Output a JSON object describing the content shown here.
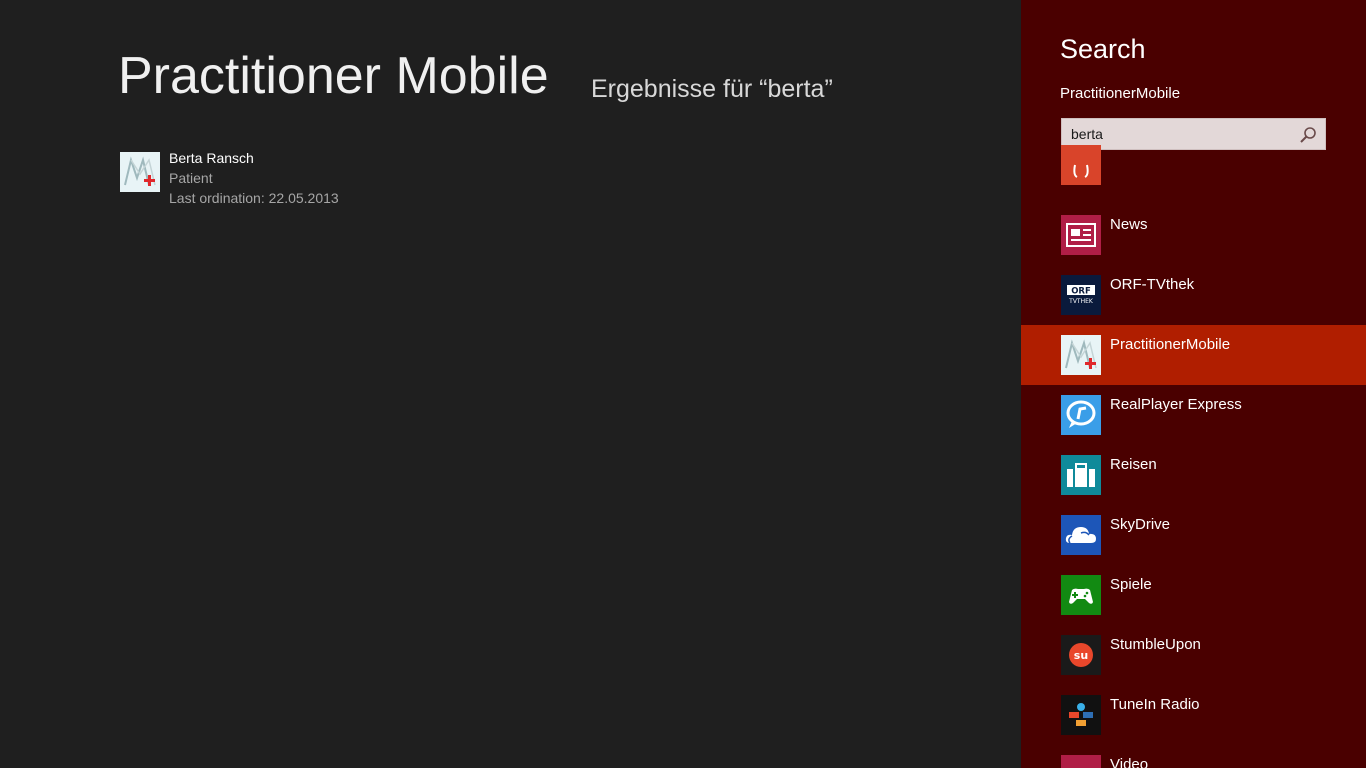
{
  "main": {
    "app_title": "Practitioner Mobile",
    "results_label": "Ergebnisse für “berta”",
    "results": [
      {
        "name": "Berta Ransch",
        "type": "Patient",
        "last_ordination": "Last ordination: 22.05.2013"
      }
    ]
  },
  "charm": {
    "title": "Search",
    "scope": "PractitionerMobile",
    "query": "berta",
    "apps": [
      {
        "label": "",
        "color": "#d9442a",
        "icon": "partial-app-icon"
      },
      {
        "label": "News",
        "color": "#b01e46",
        "icon": "news-icon"
      },
      {
        "label": "ORF-TVthek",
        "color": "#0a1a3c",
        "icon": "orf-tvthek-icon",
        "icon_text_top": "ORF",
        "icon_text_bottom": "TVTHEK"
      },
      {
        "label": "PractitionerMobile",
        "color": "#e8f4f6",
        "icon": "practitioner-mobile-icon",
        "selected": true
      },
      {
        "label": "RealPlayer Express",
        "color": "#3a9ee8",
        "icon": "realplayer-icon"
      },
      {
        "label": "Reisen",
        "color": "#0f8a9a",
        "icon": "suitcase-icon"
      },
      {
        "label": "SkyDrive",
        "color": "#1d56b8",
        "icon": "cloud-icon"
      },
      {
        "label": "Spiele",
        "color": "#128a12",
        "icon": "gamepad-icon"
      },
      {
        "label": "StumbleUpon",
        "color": "#1a1a1a",
        "icon": "stumbleupon-icon",
        "icon_text": "su"
      },
      {
        "label": "TuneIn Radio",
        "color": "#111111",
        "icon": "tunein-icon"
      },
      {
        "label": "Video",
        "color": "#b01e46",
        "icon": "video-icon"
      }
    ]
  },
  "colors": {
    "app_background": "#1f1f1f",
    "charm_background": "#4a0000",
    "selected_background": "#b01e00"
  }
}
